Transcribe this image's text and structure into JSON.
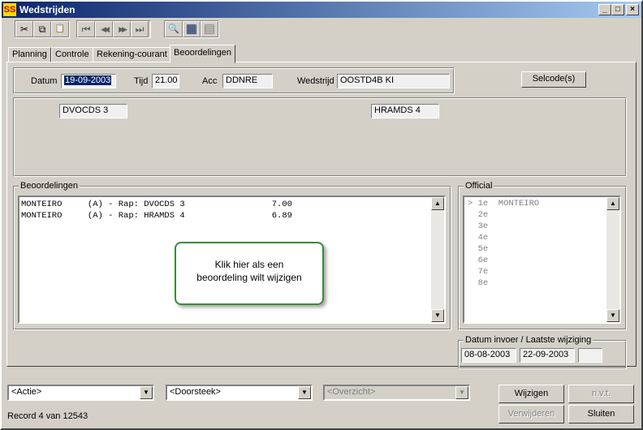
{
  "window": {
    "title": "Wedstrijden",
    "app_icon": "SS",
    "minimize": "_",
    "maximize": "□",
    "close": "×"
  },
  "toolbar": {
    "cut_icon": "✂",
    "copy_icon": "⧉",
    "paste_icon": "📋",
    "first_icon": "⏮",
    "prev_icon": "◀◀",
    "next_icon": "▶▶",
    "last_icon": "⏭",
    "search_icon": "🔍",
    "grid_icon": "▦",
    "list_icon": "▤"
  },
  "tabs": [
    {
      "label": "Planning"
    },
    {
      "label": "Controle"
    },
    {
      "label": "Rekening-courant"
    },
    {
      "label": "Beoordelingen"
    }
  ],
  "header": {
    "datum_label": "Datum",
    "datum_value": "19-09-2003",
    "tijd_label": "Tijd",
    "tijd_value": "21.00",
    "acc_label": "Acc",
    "acc_value": "DDNRE",
    "wedstrijd_label": "Wedstrijd",
    "wedstrijd_value": "OOSTD4B  KI",
    "selcode_button": "Selcode(s)"
  },
  "teams": {
    "home": "DVOCDS 3",
    "away": "HRAMDS 4"
  },
  "beoordelingen": {
    "title": "Beoordelingen",
    "rows": [
      {
        "text": "MONTEIRO     (A) - Rap: DVOCDS 3                 7.00"
      },
      {
        "text": "MONTEIRO     (A) - Rap: HRAMDS 4                 6.89"
      }
    ]
  },
  "official": {
    "title": "Official",
    "rows": [
      {
        "text": "> 1e  MONTEIRO"
      },
      {
        "text": "  2e"
      },
      {
        "text": "  3e"
      },
      {
        "text": "  4e"
      },
      {
        "text": "  5e"
      },
      {
        "text": "  6e"
      },
      {
        "text": "  7e"
      },
      {
        "text": "  8e"
      }
    ]
  },
  "dates": {
    "title": "Datum invoer / Laatste wijziging",
    "invoer": "08-08-2003",
    "wijziging": "22-09-2003",
    "extra": ""
  },
  "tooltip": {
    "line1": "Klik hier als een",
    "line2": "beoordeling wilt wijzigen"
  },
  "footer": {
    "actie": "<Actie>",
    "doorsteek": "<Doorsteek>",
    "overzicht": "<Overzicht>",
    "wijzigen": "Wijzigen",
    "nvt": "n.v.t.",
    "verwijderen": "Verwijderen",
    "sluiten": "Sluiten",
    "record": "Record 4 van 12543"
  },
  "colors": {
    "titlebar_start": "#0a246a",
    "titlebar_end": "#a6caf0",
    "face": "#d4d0c8",
    "selection": "#0a246a",
    "tooltip_border": "#3a8a3a"
  }
}
